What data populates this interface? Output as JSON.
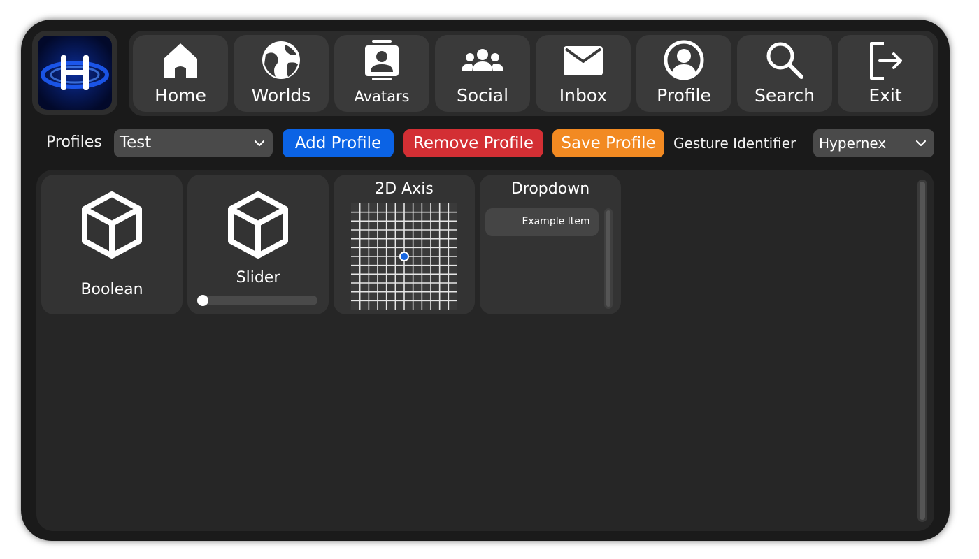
{
  "nav": {
    "items": [
      {
        "label": "Home",
        "icon": "home-icon"
      },
      {
        "label": "Worlds",
        "icon": "globe-icon"
      },
      {
        "label": "Avatars",
        "icon": "avatar-icon"
      },
      {
        "label": "Social",
        "icon": "people-icon"
      },
      {
        "label": "Inbox",
        "icon": "envelope-icon"
      },
      {
        "label": "Profile",
        "icon": "user-circle-icon"
      },
      {
        "label": "Search",
        "icon": "search-icon"
      },
      {
        "label": "Exit",
        "icon": "exit-icon"
      }
    ]
  },
  "toolbar": {
    "profiles_label": "Profiles",
    "profile_value": "Test",
    "add_profile": "Add Profile",
    "remove_profile": "Remove Profile",
    "save_profile": "Save Profile",
    "gesture_label": "Gesture Identifier",
    "gesture_value": "Hypernex"
  },
  "cards": {
    "boolean": {
      "title": "Boolean",
      "icon": "cube-icon"
    },
    "slider": {
      "title": "Slider",
      "icon": "cube-icon",
      "value": 0.0
    },
    "axis": {
      "title": "2D Axis",
      "x": 0.0,
      "y": 0.0
    },
    "dropdown": {
      "title": "Dropdown",
      "items": [
        "Example Item"
      ]
    }
  },
  "colors": {
    "add": "#0b63e5",
    "remove": "#d32f34",
    "save": "#f28a22",
    "axis_point": "#1565e0"
  }
}
